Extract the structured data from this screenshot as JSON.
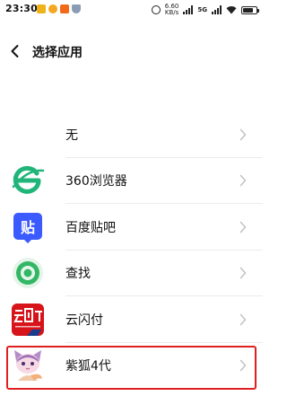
{
  "status_bar": {
    "time": "23:30",
    "net_speed_value": "6.60",
    "net_speed_unit": "KB/s",
    "network_type": "5G"
  },
  "header": {
    "title": "选择应用"
  },
  "apps": [
    {
      "label": "无",
      "icon": "none"
    },
    {
      "label": "360浏览器",
      "icon": "360-browser-icon"
    },
    {
      "label": "百度贴吧",
      "icon": "baidu-tieba-icon"
    },
    {
      "label": "查找",
      "icon": "find-icon"
    },
    {
      "label": "云闪付",
      "icon": "unionpay-quickpass-icon"
    },
    {
      "label": "紫狐4代",
      "icon": "fox-avatar-icon"
    }
  ],
  "colors": {
    "highlight_border": "#e02020",
    "browser_green": "#21b57a",
    "tieba_blue": "#3b5bff",
    "find_green": "#33b765",
    "unionpay_red": "#d7141a"
  }
}
